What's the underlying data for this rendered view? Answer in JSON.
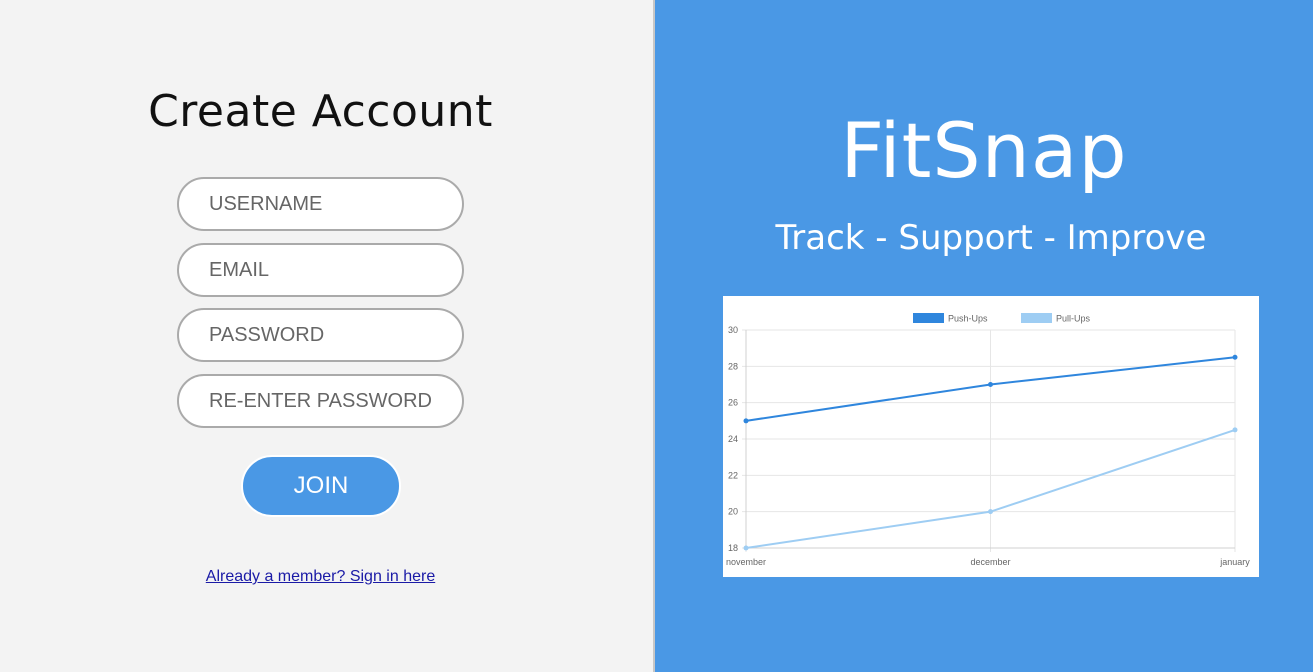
{
  "signup": {
    "title": "Create Account",
    "fields": {
      "username_placeholder": "USERNAME",
      "email_placeholder": "EMAIL",
      "password_placeholder": "PASSWORD",
      "reenter_placeholder": "RE-ENTER PASSWORD"
    },
    "join_label": "JOIN",
    "signin_link": "Already a member? Sign in here"
  },
  "brand": {
    "name": "FitSnap",
    "tagline": "Track - Support - Improve"
  },
  "colors": {
    "accent": "#4a98e5",
    "pushups": "#2f86dd",
    "pullups": "#9ecdf3"
  },
  "chart_data": {
    "type": "line",
    "categories": [
      "november",
      "december",
      "january"
    ],
    "series": [
      {
        "name": "Push-Ups",
        "values": [
          25,
          27,
          28.5
        ]
      },
      {
        "name": "Pull-Ups",
        "values": [
          18,
          20,
          24.5
        ]
      }
    ],
    "ylim": [
      18,
      30
    ],
    "yticks": [
      18,
      20,
      22,
      24,
      26,
      28,
      30
    ],
    "legend": "top-center",
    "grid": true
  }
}
